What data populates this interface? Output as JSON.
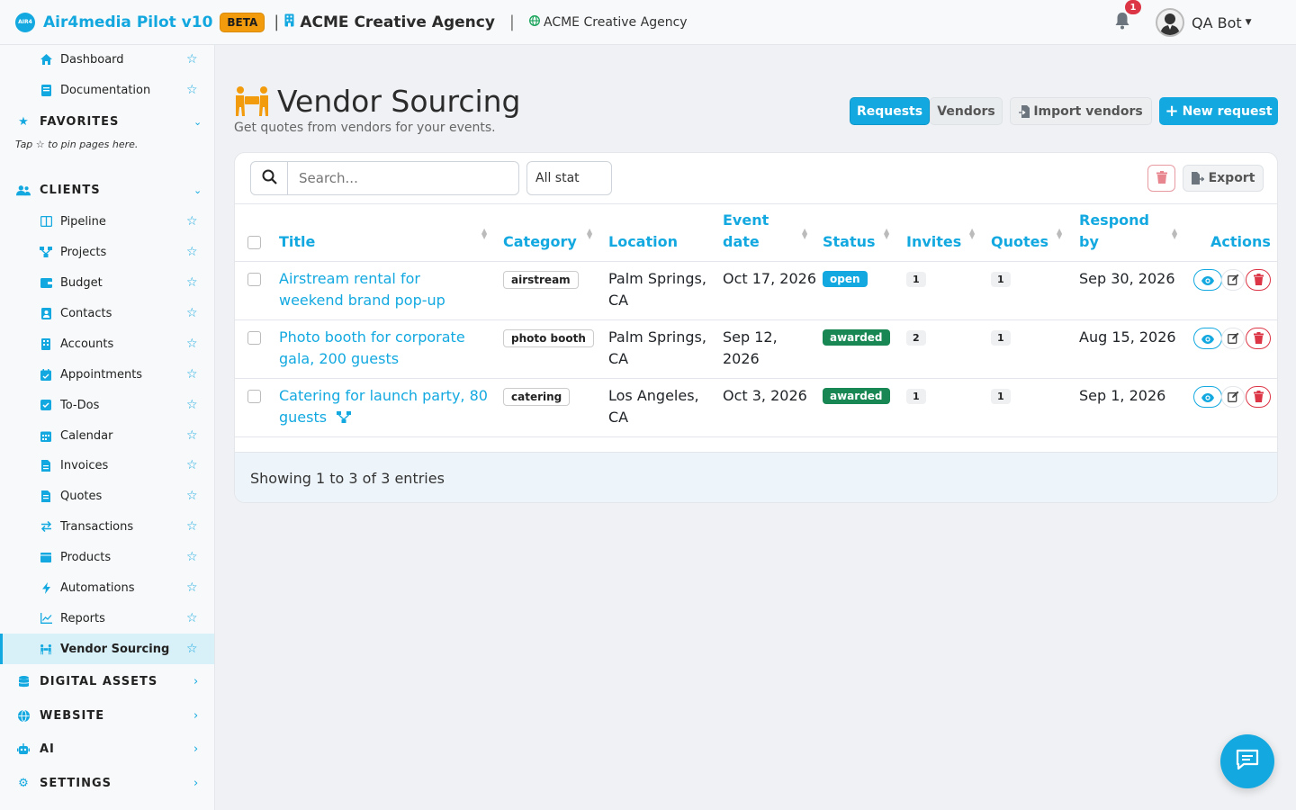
{
  "header": {
    "app_name": "Air4media Pilot v10",
    "logo_text": "AIR4",
    "beta_label": "BETA",
    "org_name": "ACME Creative Agency",
    "website_name": "ACME Creative Agency",
    "notification_count": "1",
    "user_name": "QA Bot"
  },
  "sidebar": {
    "top_items": [
      {
        "label": "Dashboard",
        "icon": "home-icon"
      },
      {
        "label": "Documentation",
        "icon": "book-icon"
      }
    ],
    "favorites": {
      "label": "FAVORITES",
      "hint": "Tap ☆ to pin pages here."
    },
    "clients": {
      "label": "CLIENTS"
    },
    "client_items": [
      {
        "label": "Pipeline"
      },
      {
        "label": "Projects"
      },
      {
        "label": "Budget"
      },
      {
        "label": "Contacts"
      },
      {
        "label": "Accounts"
      },
      {
        "label": "Appointments"
      },
      {
        "label": "To-Dos"
      },
      {
        "label": "Calendar"
      },
      {
        "label": "Invoices"
      },
      {
        "label": "Quotes"
      },
      {
        "label": "Transactions"
      },
      {
        "label": "Products"
      },
      {
        "label": "Automations"
      },
      {
        "label": "Reports"
      },
      {
        "label": "Vendor Sourcing"
      }
    ],
    "sections": [
      {
        "label": "DIGITAL ASSETS"
      },
      {
        "label": "WEBSITE"
      },
      {
        "label": "AI"
      },
      {
        "label": "SETTINGS"
      }
    ]
  },
  "page": {
    "title": "Vendor Sourcing",
    "subtitle": "Get quotes from vendors for your events.",
    "tab_requests": "Requests",
    "tab_vendors": "Vendors",
    "import_label": "Import vendors",
    "new_request_label": "New request"
  },
  "toolbar": {
    "search_placeholder": "Search...",
    "status_filter": "All stat",
    "export_label": "Export"
  },
  "table": {
    "columns": [
      "Title",
      "Category",
      "Location",
      "Event date",
      "Status",
      "Invites",
      "Quotes",
      "Respond by",
      "Actions"
    ],
    "rows": [
      {
        "title": "Airstream rental for weekend brand pop-up",
        "category": "airstream",
        "location": "Palm Springs, CA",
        "event_date": "Oct 17, 2026",
        "status": "open",
        "invites": "1",
        "quotes": "1",
        "respond_by": "Sep 30, 2026"
      },
      {
        "title": "Photo booth for corporate gala, 200 guests",
        "category": "photo booth",
        "location": "Palm Springs, CA",
        "event_date": "Sep 12, 2026",
        "status": "awarded",
        "invites": "2",
        "quotes": "1",
        "respond_by": "Aug 15, 2026"
      },
      {
        "title": "Catering for launch party, 80 guests",
        "category": "catering",
        "location": "Los Angeles, CA",
        "event_date": "Oct 3, 2026",
        "status": "awarded",
        "invites": "1",
        "quotes": "1",
        "respond_by": "Sep 1, 2026"
      }
    ],
    "footer": "Showing 1 to 3 of 3 entries"
  },
  "colors": {
    "accent": "#13a9e0",
    "beta": "#f29b0c",
    "awarded": "#198754",
    "danger": "#dc3545"
  }
}
